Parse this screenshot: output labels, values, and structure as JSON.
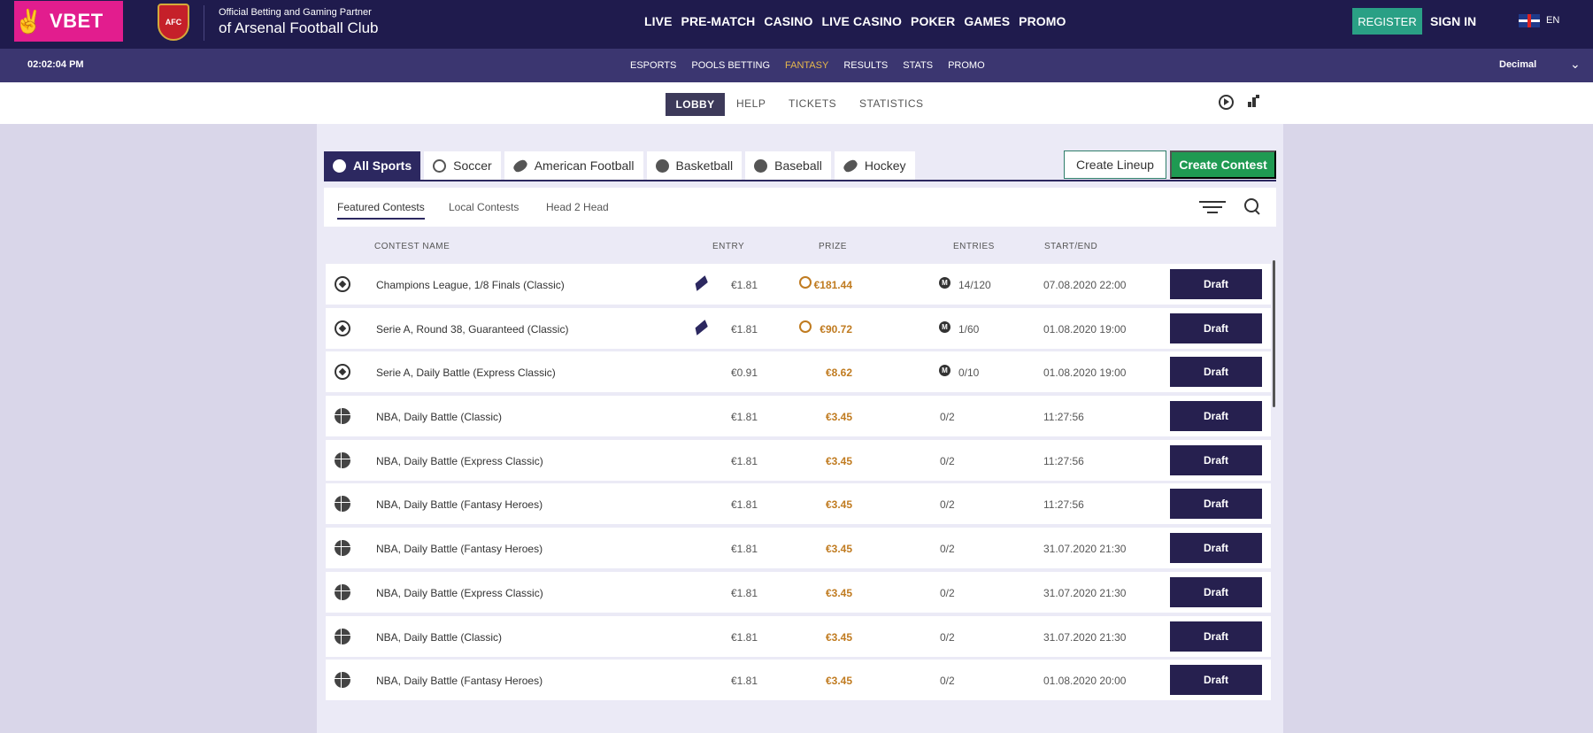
{
  "header": {
    "brand": "VBET",
    "partner_line1": "Official Betting and Gaming Partner",
    "partner_line2": "of Arsenal Football Club",
    "nav": [
      "LIVE",
      "PRE-MATCH",
      "CASINO",
      "LIVE CASINO",
      "POKER",
      "GAMES",
      "PROMO"
    ],
    "register": "REGISTER",
    "signin": "SIGN IN",
    "lang": "EN"
  },
  "subheader": {
    "clock": "02:02:04 PM",
    "nav": [
      "ESPORTS",
      "POOLS BETTING",
      "FANTASY",
      "RESULTS",
      "STATS",
      "PROMO"
    ],
    "active": "FANTASY",
    "odds_format": "Decimal"
  },
  "fantasy_nav": {
    "items": [
      "LOBBY",
      "HELP",
      "TICKETS",
      "STATISTICS"
    ]
  },
  "sport_tabs": [
    "All Sports",
    "Soccer",
    "American Football",
    "Basketball",
    "Baseball",
    "Hockey"
  ],
  "actions": {
    "create_lineup": "Create Lineup",
    "create_contest": "Create Contest"
  },
  "contest_tabs": [
    "Featured Contests",
    "Local Contests",
    "Head 2 Head"
  ],
  "table": {
    "headers": {
      "name": "CONTEST NAME",
      "entry": "ENTRY",
      "prize": "PRIZE",
      "entries": "ENTRIES",
      "start": "START/END"
    },
    "rows": [
      {
        "sport": "soccer",
        "name": "Champions League, 1/8 Finals (Classic)",
        "entry": "€1.81",
        "ticket": true,
        "prize": "€181.44",
        "coin": true,
        "entries": "14/120",
        "badge": "M",
        "date": "07.08.2020 22:00",
        "action": "Draft"
      },
      {
        "sport": "soccer",
        "name": "Serie A, Round 38, Guaranteed (Classic)",
        "entry": "€1.81",
        "ticket": true,
        "prize": "€90.72",
        "coin": true,
        "entries": "1/60",
        "badge": "M",
        "date": "01.08.2020 19:00",
        "action": "Draft"
      },
      {
        "sport": "soccer",
        "name": "Serie A, Daily Battle (Express Classic)",
        "entry": "€0.91",
        "ticket": false,
        "prize": "€8.62",
        "coin": false,
        "entries": "0/10",
        "badge": "M",
        "date": "01.08.2020 19:00",
        "action": "Draft"
      },
      {
        "sport": "basketball",
        "name": "NBA, Daily Battle (Classic)",
        "entry": "€1.81",
        "ticket": false,
        "prize": "€3.45",
        "coin": false,
        "entries": "0/2",
        "badge": "",
        "date": "11:27:56",
        "action": "Draft"
      },
      {
        "sport": "basketball",
        "name": "NBA, Daily Battle (Express Classic)",
        "entry": "€1.81",
        "ticket": false,
        "prize": "€3.45",
        "coin": false,
        "entries": "0/2",
        "badge": "",
        "date": "11:27:56",
        "action": "Draft"
      },
      {
        "sport": "basketball",
        "name": "NBA, Daily Battle (Fantasy Heroes)",
        "entry": "€1.81",
        "ticket": false,
        "prize": "€3.45",
        "coin": false,
        "entries": "0/2",
        "badge": "",
        "date": "11:27:56",
        "action": "Draft"
      },
      {
        "sport": "basketball",
        "name": "NBA, Daily Battle (Fantasy Heroes)",
        "entry": "€1.81",
        "ticket": false,
        "prize": "€3.45",
        "coin": false,
        "entries": "0/2",
        "badge": "",
        "date": "31.07.2020 21:30",
        "action": "Draft"
      },
      {
        "sport": "basketball",
        "name": "NBA, Daily Battle (Express Classic)",
        "entry": "€1.81",
        "ticket": false,
        "prize": "€3.45",
        "coin": false,
        "entries": "0/2",
        "badge": "",
        "date": "31.07.2020 21:30",
        "action": "Draft"
      },
      {
        "sport": "basketball",
        "name": "NBA, Daily Battle (Classic)",
        "entry": "€1.81",
        "ticket": false,
        "prize": "€3.45",
        "coin": false,
        "entries": "0/2",
        "badge": "",
        "date": "31.07.2020 21:30",
        "action": "Draft"
      },
      {
        "sport": "basketball",
        "name": "NBA, Daily Battle (Fantasy Heroes)",
        "entry": "€1.81",
        "ticket": false,
        "prize": "€3.45",
        "coin": false,
        "entries": "0/2",
        "badge": "",
        "date": "01.08.2020 20:00",
        "action": "Draft"
      }
    ]
  },
  "colors": {
    "header": "#1f1b4d",
    "subheader": "#3b3670",
    "accent": "#e7b84c",
    "brand": "#e21d8e",
    "register": "#2aa085",
    "create": "#1f9a52",
    "draft": "#26204f",
    "prize": "#c07b20"
  }
}
